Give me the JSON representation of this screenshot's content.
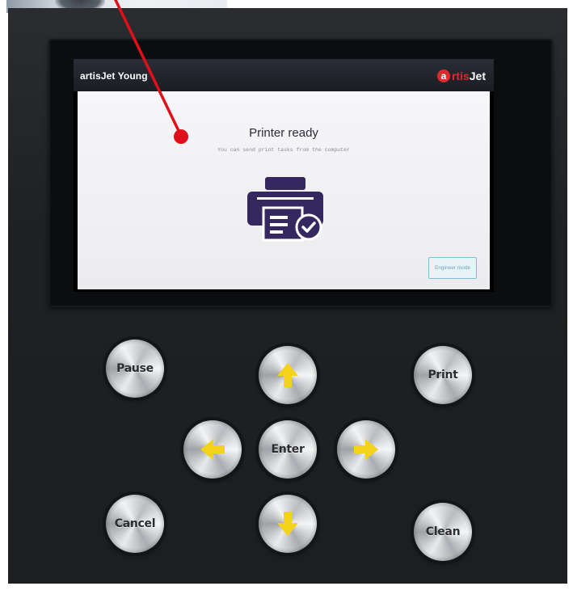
{
  "screen": {
    "header": {
      "title": "artisJet Young",
      "brand": {
        "mark": "a",
        "part1": "rtis",
        "part2": "Jet"
      }
    },
    "status_title": "Printer ready",
    "status_subtitle": "You can send print tasks from the computer",
    "engineer_mode_label": "Engineer mode",
    "icon": "printer-check-icon"
  },
  "keypad": {
    "pause_label": "Pause",
    "print_label": "Print",
    "enter_label": "Enter",
    "cancel_label": "Cancel",
    "clean_label": "Clean",
    "up_icon": "arrow-up-icon",
    "down_icon": "arrow-down-icon",
    "left_icon": "arrow-left-icon",
    "right_icon": "arrow-right-icon"
  },
  "colors": {
    "panel": "#1e2023",
    "arrow": "#f3d21a",
    "pointer": "#e0101a",
    "printer_icon": "#35275f",
    "brand": "#e0292f"
  }
}
